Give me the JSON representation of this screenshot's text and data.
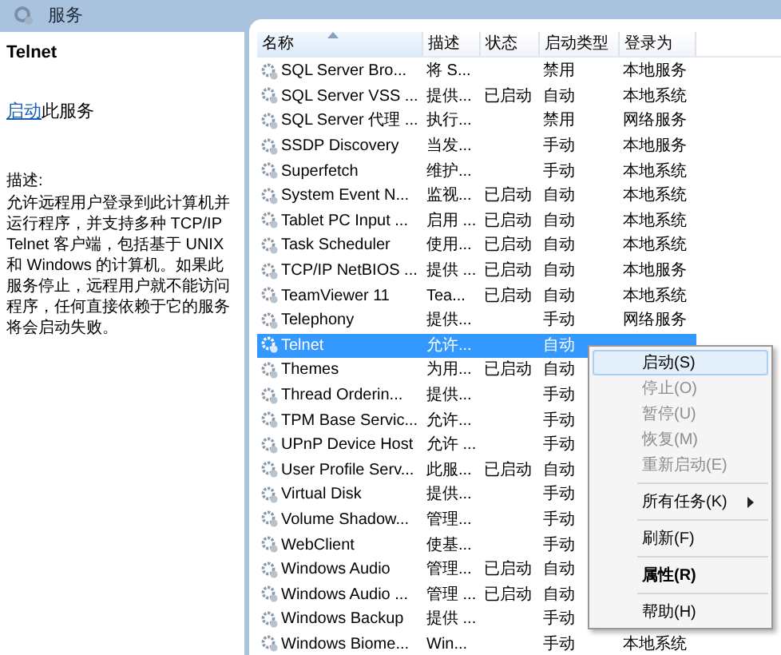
{
  "window": {
    "title": "服务"
  },
  "details": {
    "service_name": "Telnet",
    "action_link": "启动",
    "action_text": "此服务",
    "description_label": "描述:",
    "description": "允许远程用户登录到此计算机并运行程序，并支持多种 TCP/IP Telnet 客户端，包括基于 UNIX 和 Windows 的计算机。如果此服务停止，远程用户就不能访问程序，任何直接依赖于它的服务将会启动失败。"
  },
  "table": {
    "columns": [
      {
        "label": "名称",
        "sorted": true
      },
      {
        "label": "描述",
        "sorted": false
      },
      {
        "label": "状态",
        "sorted": false
      },
      {
        "label": "启动类型",
        "sorted": false
      },
      {
        "label": "登录为",
        "sorted": false
      }
    ],
    "rows": [
      {
        "name": "SQL Server Bro...",
        "description": "将 S...",
        "status": "",
        "startup": "禁用",
        "logon": "本地服务",
        "selected": false
      },
      {
        "name": "SQL Server VSS ...",
        "description": "提供...",
        "status": "已启动",
        "startup": "自动",
        "logon": "本地系统",
        "selected": false
      },
      {
        "name": "SQL Server 代理 ...",
        "description": "执行...",
        "status": "",
        "startup": "禁用",
        "logon": "网络服务",
        "selected": false
      },
      {
        "name": "SSDP Discovery",
        "description": "当发...",
        "status": "",
        "startup": "手动",
        "logon": "本地服务",
        "selected": false
      },
      {
        "name": "Superfetch",
        "description": "维护...",
        "status": "",
        "startup": "手动",
        "logon": "本地系统",
        "selected": false
      },
      {
        "name": "System Event N...",
        "description": "监视...",
        "status": "已启动",
        "startup": "自动",
        "logon": "本地系统",
        "selected": false
      },
      {
        "name": "Tablet PC Input ...",
        "description": "启用 ...",
        "status": "已启动",
        "startup": "自动",
        "logon": "本地系统",
        "selected": false
      },
      {
        "name": "Task Scheduler",
        "description": "使用...",
        "status": "已启动",
        "startup": "自动",
        "logon": "本地系统",
        "selected": false
      },
      {
        "name": "TCP/IP NetBIOS ...",
        "description": "提供 ...",
        "status": "已启动",
        "startup": "自动",
        "logon": "本地服务",
        "selected": false
      },
      {
        "name": "TeamViewer 11",
        "description": "Tea...",
        "status": "已启动",
        "startup": "自动",
        "logon": "本地系统",
        "selected": false
      },
      {
        "name": "Telephony",
        "description": "提供...",
        "status": "",
        "startup": "手动",
        "logon": "网络服务",
        "selected": false
      },
      {
        "name": "Telnet",
        "description": "允许...",
        "status": "",
        "startup": "自动",
        "logon": "",
        "selected": true
      },
      {
        "name": "Themes",
        "description": "为用...",
        "status": "已启动",
        "startup": "自动",
        "logon": "",
        "selected": false
      },
      {
        "name": "Thread Orderin...",
        "description": "提供...",
        "status": "",
        "startup": "手动",
        "logon": "",
        "selected": false
      },
      {
        "name": "TPM Base Servic...",
        "description": "允许...",
        "status": "",
        "startup": "手动",
        "logon": "",
        "selected": false
      },
      {
        "name": "UPnP Device Host",
        "description": "允许 ...",
        "status": "",
        "startup": "手动",
        "logon": "",
        "selected": false
      },
      {
        "name": "User Profile Serv...",
        "description": "此服...",
        "status": "已启动",
        "startup": "自动",
        "logon": "",
        "selected": false
      },
      {
        "name": "Virtual Disk",
        "description": "提供...",
        "status": "",
        "startup": "手动",
        "logon": "",
        "selected": false
      },
      {
        "name": "Volume Shadow...",
        "description": "管理...",
        "status": "",
        "startup": "手动",
        "logon": "",
        "selected": false
      },
      {
        "name": "WebClient",
        "description": "使基...",
        "status": "",
        "startup": "手动",
        "logon": "",
        "selected": false
      },
      {
        "name": "Windows Audio",
        "description": "管理...",
        "status": "已启动",
        "startup": "自动",
        "logon": "",
        "selected": false
      },
      {
        "name": "Windows Audio ...",
        "description": "管理 ...",
        "status": "已启动",
        "startup": "自动",
        "logon": "",
        "selected": false
      },
      {
        "name": "Windows Backup",
        "description": "提供 ...",
        "status": "",
        "startup": "手动",
        "logon": "",
        "selected": false
      },
      {
        "name": "Windows Biome...",
        "description": "Win...",
        "status": "",
        "startup": "手动",
        "logon": "本地系统",
        "selected": false
      }
    ]
  },
  "context_menu": {
    "items": [
      {
        "kind": "item",
        "label": "启动(S)",
        "disabled": false,
        "selected": true,
        "bold": false,
        "submenu": false
      },
      {
        "kind": "item",
        "label": "停止(O)",
        "disabled": true,
        "selected": false,
        "bold": false,
        "submenu": false
      },
      {
        "kind": "item",
        "label": "暂停(U)",
        "disabled": true,
        "selected": false,
        "bold": false,
        "submenu": false
      },
      {
        "kind": "item",
        "label": "恢复(M)",
        "disabled": true,
        "selected": false,
        "bold": false,
        "submenu": false
      },
      {
        "kind": "item",
        "label": "重新启动(E)",
        "disabled": true,
        "selected": false,
        "bold": false,
        "submenu": false
      },
      {
        "kind": "separator"
      },
      {
        "kind": "item",
        "label": "所有任务(K)",
        "disabled": false,
        "selected": false,
        "bold": false,
        "submenu": true
      },
      {
        "kind": "separator"
      },
      {
        "kind": "item",
        "label": "刷新(F)",
        "disabled": false,
        "selected": false,
        "bold": false,
        "submenu": false
      },
      {
        "kind": "separator"
      },
      {
        "kind": "item",
        "label": "属性(R)",
        "disabled": false,
        "selected": false,
        "bold": true,
        "submenu": false
      },
      {
        "kind": "separator"
      },
      {
        "kind": "item",
        "label": "帮助(H)",
        "disabled": false,
        "selected": false,
        "bold": false,
        "submenu": false
      }
    ]
  }
}
